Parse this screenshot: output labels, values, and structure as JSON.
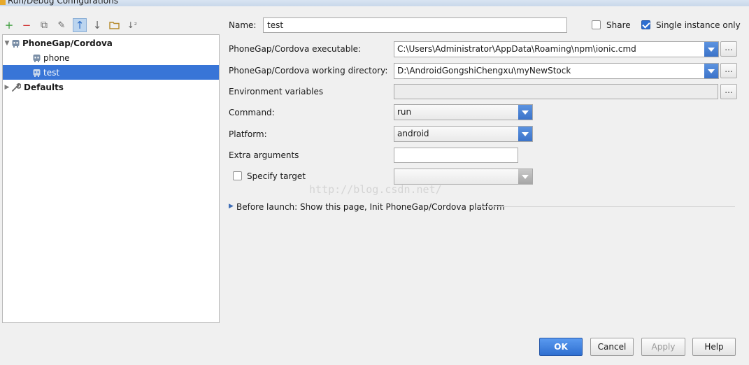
{
  "window": {
    "title": "Run/Debug Configurations"
  },
  "toolbar": {
    "buttons": [
      {
        "icon": "add-icon",
        "glyph": "+",
        "color": "#3a9c3a"
      },
      {
        "icon": "remove-icon",
        "glyph": "−",
        "color": "#d23a3a"
      },
      {
        "icon": "copy-icon",
        "glyph": "⧉",
        "color": "#666666"
      },
      {
        "icon": "edit-defaults-icon",
        "glyph": "✎",
        "color": "#666666"
      },
      {
        "icon": "move-up-icon",
        "glyph": "↑",
        "color": "#2c6bc4"
      },
      {
        "icon": "move-down-icon",
        "glyph": "↓",
        "color": "#666666"
      },
      {
        "icon": "folder-icon",
        "glyph": "▭",
        "color": "#b58a2a"
      },
      {
        "icon": "sort-icon",
        "glyph": "↓ᶻ",
        "color": "#666666"
      }
    ]
  },
  "tree": {
    "group": "PhoneGap/Cordova",
    "items": [
      "phone",
      "test"
    ],
    "selected": "test",
    "defaults": "Defaults"
  },
  "form": {
    "name_label": "Name:",
    "name_value": "test",
    "share_label": "Share",
    "share_checked": false,
    "single_instance_label": "Single instance only",
    "single_instance_checked": true,
    "executable_label": "PhoneGap/Cordova executable:",
    "executable_value": "C:\\Users\\Administrator\\AppData\\Roaming\\npm\\ionic.cmd",
    "workdir_label": "PhoneGap/Cordova working directory:",
    "workdir_value": "D:\\AndroidGongshiChengxu\\myNewStock",
    "env_label": "Environment variables",
    "env_value": "",
    "command_label": "Command:",
    "command_value": "run",
    "platform_label": "Platform:",
    "platform_value": "android",
    "extra_label": "Extra arguments",
    "extra_value": "",
    "target_label": "Specify target",
    "target_checked": false,
    "target_value": "",
    "browse_label": "...",
    "before_launch": "Before launch: Show this page, Init PhoneGap/Cordova platform"
  },
  "watermark": "http://blog.csdn.net/",
  "buttons": {
    "ok": "OK",
    "cancel": "Cancel",
    "apply": "Apply",
    "help": "Help"
  },
  "colors": {
    "selection": "#3875d7",
    "primary_button": "#3a7fe0",
    "dropdown": "#4a85d8"
  }
}
